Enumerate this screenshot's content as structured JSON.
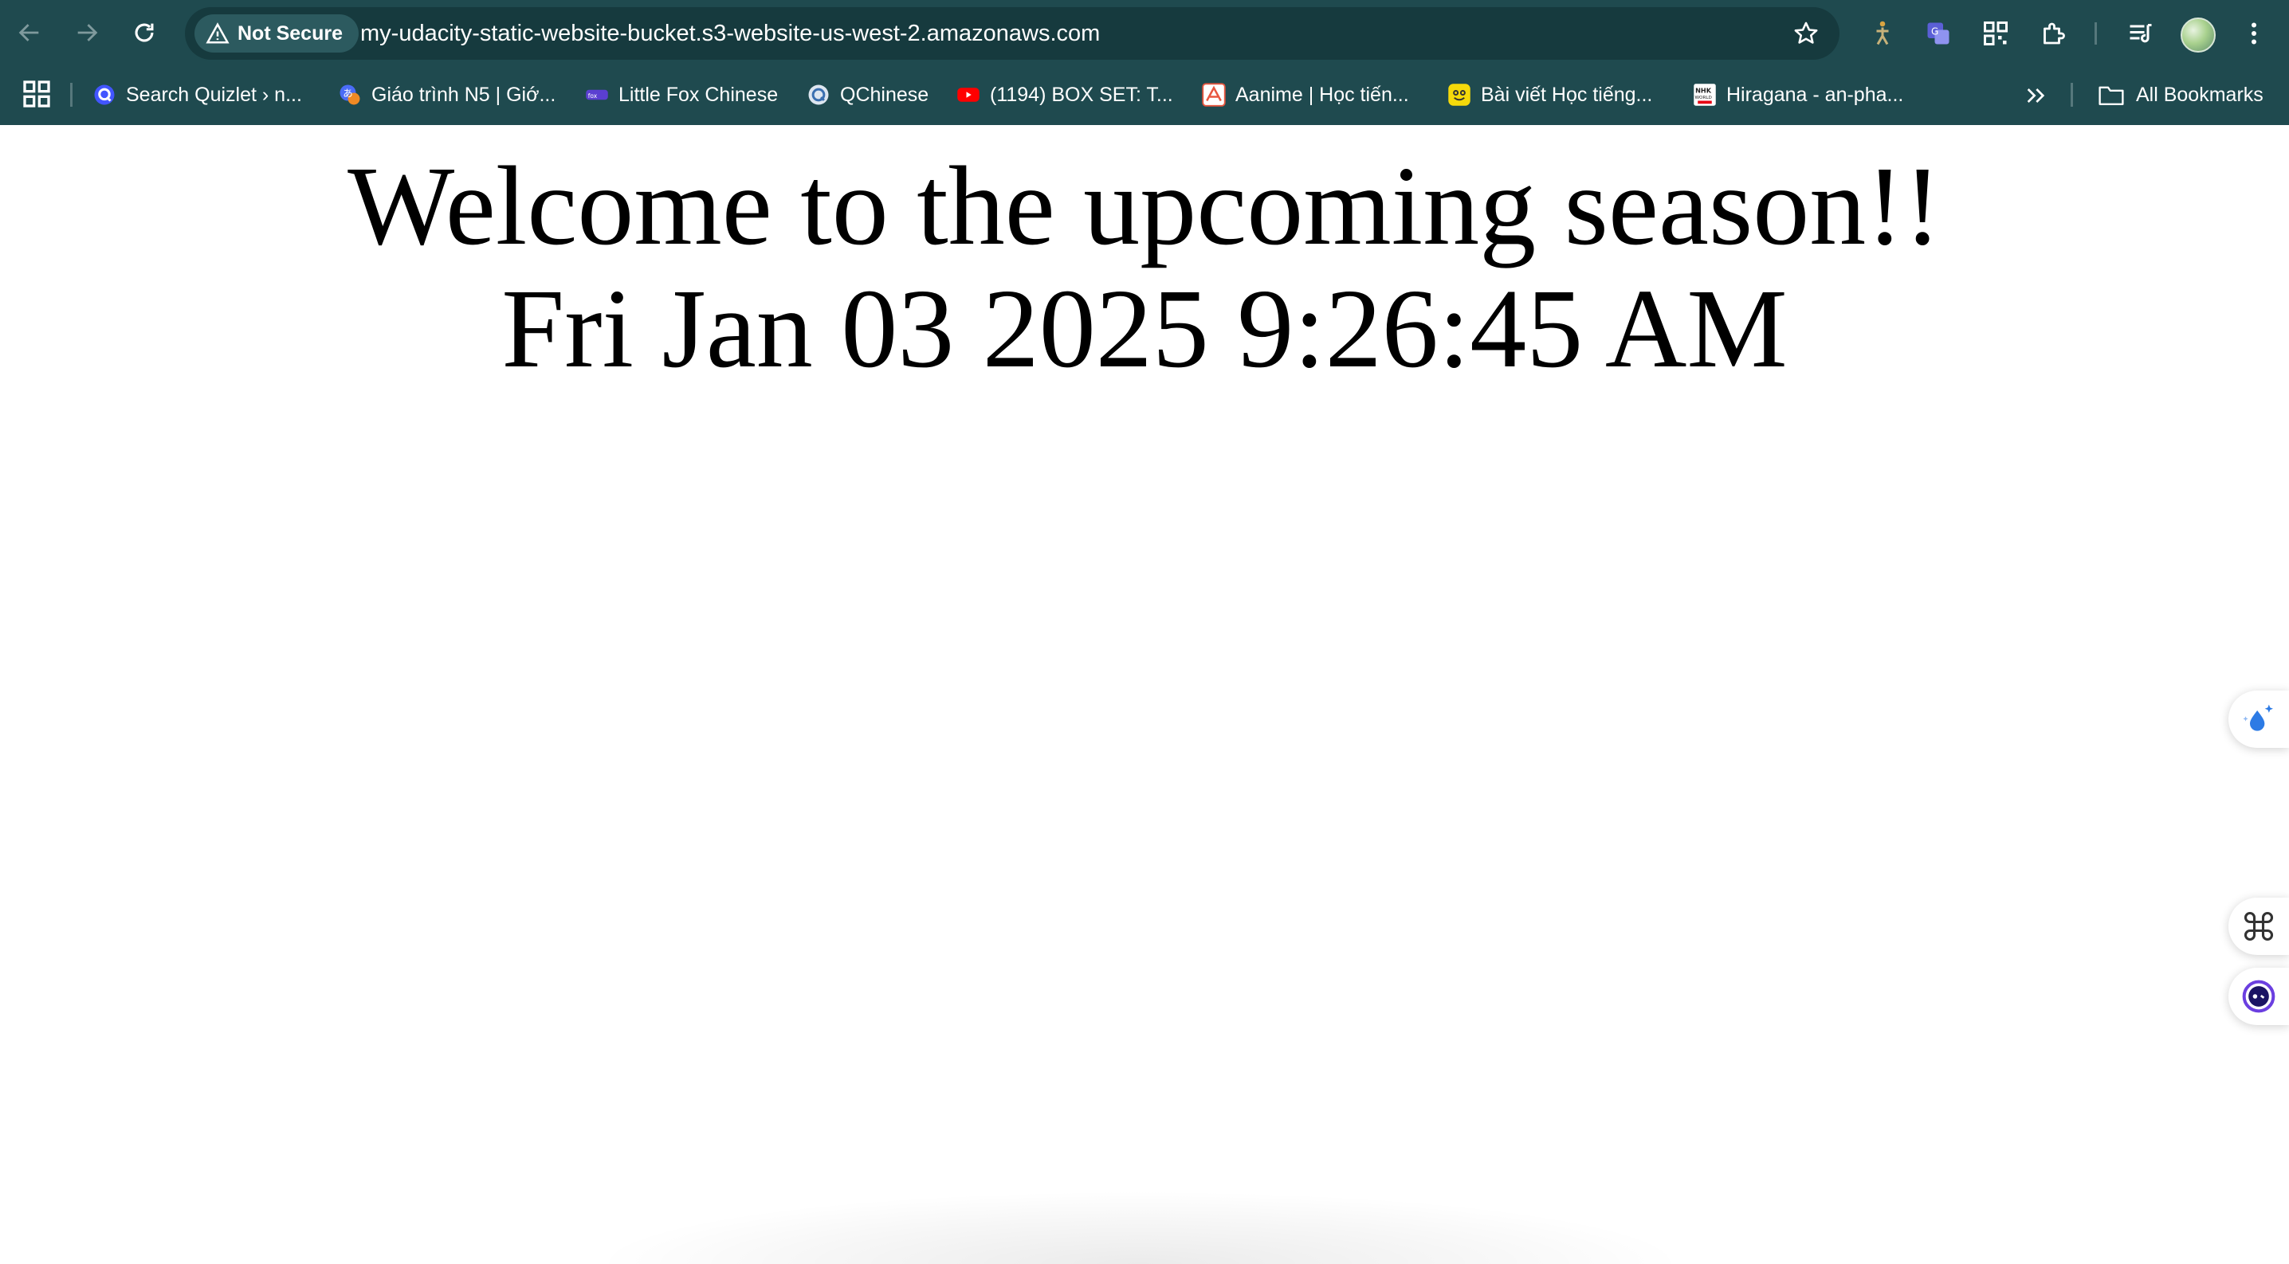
{
  "browser": {
    "security_label": "Not Secure",
    "url": "my-udacity-static-website-bucket.s3-website-us-west-2.amazonaws.com",
    "nav": {
      "back_icon": "arrow-left-icon",
      "forward_icon": "arrow-right-icon",
      "reload_icon": "reload-icon"
    },
    "extensions": [
      "figure-extension-icon",
      "translate-extension-icon",
      "qr-code-icon",
      "puzzle-extensions-icon",
      "reading-list-icon"
    ],
    "bookmarks": [
      {
        "label": "Search Quizlet › n...",
        "icon": "quizlet-icon",
        "color": "#4255ff"
      },
      {
        "label": "Giáo trình N5 | Giớ...",
        "icon": "translate-bubble-icon",
        "color": "#4a6cf7"
      },
      {
        "label": "Little Fox Chinese",
        "icon": "little-fox-icon",
        "color": "#5b3fd1"
      },
      {
        "label": "QChinese",
        "icon": "qchinese-icon",
        "color": "#7a9bc2"
      },
      {
        "label": "(1194) BOX SET: T...",
        "icon": "youtube-icon",
        "color": "#ff0000"
      },
      {
        "label": "Aanime | Học tiến...",
        "icon": "aanime-icon",
        "color": "#e8563f"
      },
      {
        "label": "Bài viết Học tiếng...",
        "icon": "smiley-icon",
        "color": "#f5d90a"
      },
      {
        "label": "Hiragana - an-pha...",
        "icon": "nhk-world-icon",
        "color": "#ffffff"
      }
    ],
    "all_bookmarks_label": "All Bookmarks"
  },
  "page": {
    "heading": "Welcome to the upcoming season!!",
    "datetime": "Fri Jan 03 2025 9:26:45 AM"
  },
  "colors": {
    "chrome": "#1f4a4f",
    "omnibox": "#163a3e",
    "page_background": "#ffffff",
    "text": "#000000"
  }
}
